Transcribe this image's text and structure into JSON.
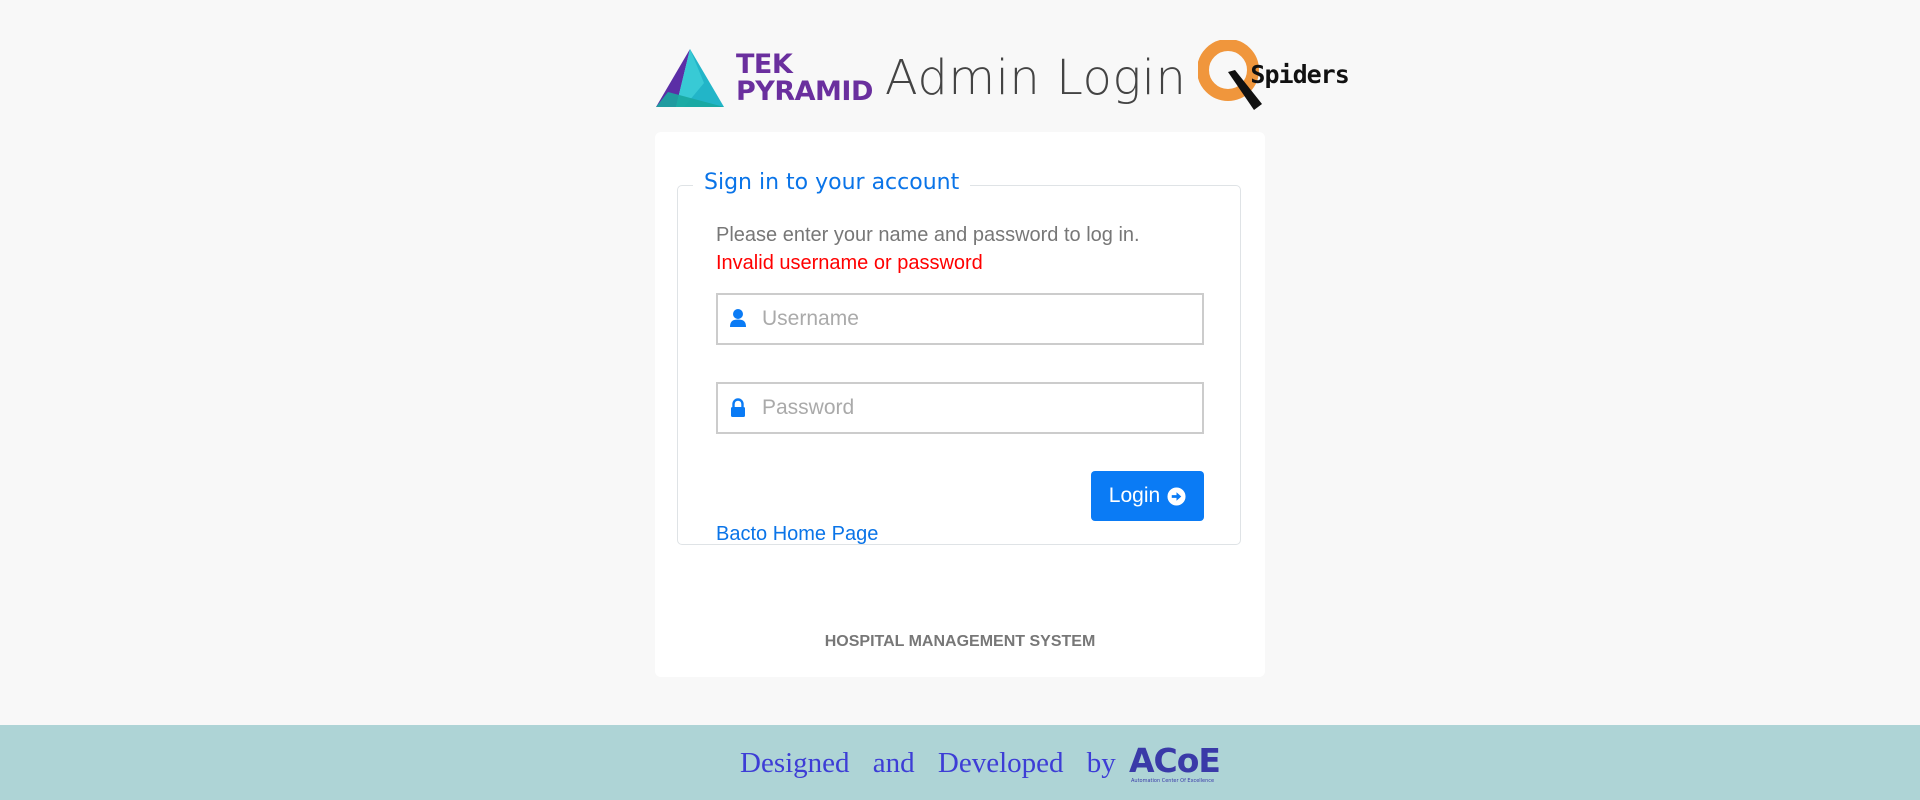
{
  "header": {
    "tek_logo": {
      "line1": "TEK",
      "line2": "PYRAMID"
    },
    "title": "Admin Login",
    "qspiders_logo": {
      "text": "Spiders"
    }
  },
  "form": {
    "legend": "Sign in to your account",
    "instructions": "Please enter your name and password to log in.",
    "error": "Invalid username or password",
    "username": {
      "placeholder": "Username",
      "value": "",
      "icon": "user-icon"
    },
    "password": {
      "placeholder": "Password",
      "value": "",
      "icon": "lock-icon"
    },
    "login_button": {
      "label": "Login",
      "icon": "arrow-circle-right-icon"
    },
    "home_link": "Bacto Home Page"
  },
  "system_name": "HOSPITAL MANAGEMENT SYSTEM",
  "footer": {
    "text": "Designed and Developed by",
    "logo": {
      "text": "ACoE",
      "subtext": "Automation Center Of Excellence"
    }
  },
  "colors": {
    "accent": "#0a7bf5",
    "error": "#ff0000",
    "footer_bg": "#aed4d6",
    "footer_text": "#3d3dd6"
  }
}
